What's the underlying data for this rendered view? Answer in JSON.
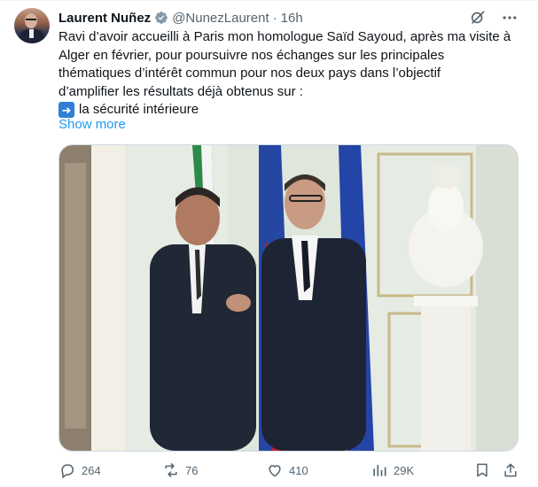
{
  "tweet": {
    "author": {
      "name": "Laurent Nuñez",
      "verified": true,
      "handle": "@NunezLaurent",
      "separator": "·",
      "time": "16h"
    },
    "body_lines": [
      "Ravi d’avoir accueilli à Paris mon homologue Saïd Sayoud, après ma visite à",
      "Alger en février, pour poursuivre nos échanges sur les principales",
      "thématiques d’intérêt commun pour nos deux pays dans l’objectif",
      "d’amplifier les résultats déjà obtenus sur :"
    ],
    "bullet": {
      "icon": "right-arrow-emoji",
      "text": "la sécurité intérieure"
    },
    "show_more": "Show more",
    "media": {
      "description_icon": "photo"
    },
    "actions": {
      "replies": "264",
      "reposts": "76",
      "likes": "410",
      "views": "29K"
    },
    "top_icons": [
      "grok-icon",
      "more-icon"
    ]
  },
  "colors": {
    "text": "#0f1419",
    "muted": "#536471",
    "link": "#1d9bf0",
    "verified_badge": "#829aab",
    "border": "#cfd9de"
  }
}
